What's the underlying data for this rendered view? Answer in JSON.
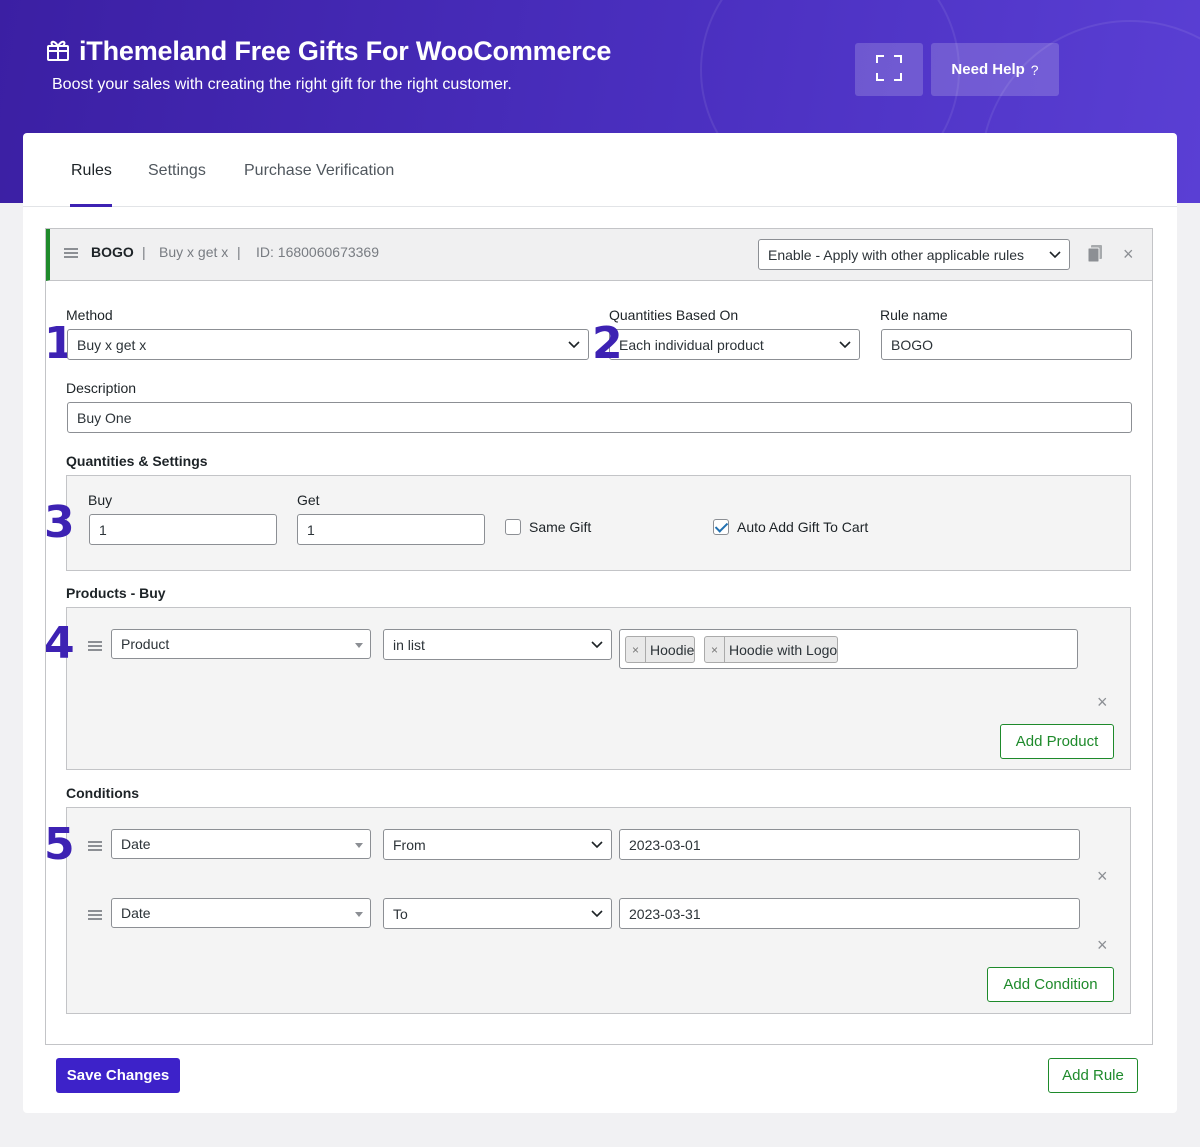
{
  "header": {
    "title": "iThemeland Free Gifts For WooCommerce",
    "subtitle": "Boost your sales with creating the right gift for the right customer.",
    "help_label": "Need Help",
    "help_suffix": "?"
  },
  "tabs": [
    {
      "label": "Rules",
      "active": true
    },
    {
      "label": "Settings",
      "active": false
    },
    {
      "label": "Purchase Verification",
      "active": false
    }
  ],
  "rule": {
    "name": "BOGO",
    "method_short": "Buy x get x",
    "id_text": "ID: 1680060673369",
    "separator": "|",
    "status": "Enable - Apply with other applicable rules",
    "numbers": [
      "1",
      "2",
      "3",
      "4",
      "5"
    ],
    "fields": {
      "method_label": "Method",
      "method_value": "Buy x get x",
      "qty_based_label": "Quantities Based On",
      "qty_based_value": "Each individual product",
      "rule_name_label": "Rule name",
      "rule_name_value": "BOGO",
      "description_label": "Description",
      "description_value": "Buy One"
    },
    "quantities": {
      "section_label": "Quantities & Settings",
      "buy_label": "Buy",
      "buy_value": "1",
      "get_label": "Get",
      "get_value": "1",
      "same_gift_label": "Same Gift",
      "same_gift_checked": false,
      "auto_add_label": "Auto Add Gift To Cart",
      "auto_add_checked": true
    },
    "products_buy": {
      "section_label": "Products - Buy",
      "type": "Product",
      "operator": "in list",
      "tags": [
        "Hoodie",
        "Hoodie with Logo"
      ],
      "tag_remove": "×",
      "add_label": "Add Product"
    },
    "conditions": {
      "section_label": "Conditions",
      "rows": [
        {
          "type": "Date",
          "operator": "From",
          "value": "2023-03-01"
        },
        {
          "type": "Date",
          "operator": "To",
          "value": "2023-03-31"
        }
      ],
      "add_label": "Add Condition"
    }
  },
  "footer": {
    "save_label": "Save Changes",
    "add_rule_label": "Add Rule"
  },
  "icons": {
    "close": "×",
    "accent_color": "#3d22b3",
    "green": "#1e8a2b"
  }
}
